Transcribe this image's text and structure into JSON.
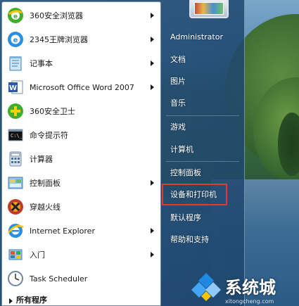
{
  "left_programs": [
    {
      "label": "360安全浏览器",
      "icon": "360-browser-icon",
      "has_arrow": true
    },
    {
      "label": "2345王牌浏览器",
      "icon": "2345-browser-icon",
      "has_arrow": true
    },
    {
      "label": "记事本",
      "icon": "notepad-icon",
      "has_arrow": true
    },
    {
      "label": "Microsoft Office Word 2007",
      "icon": "word-icon",
      "has_arrow": true
    },
    {
      "label": "360安全卫士",
      "icon": "360-safe-icon",
      "has_arrow": false
    },
    {
      "label": "命令提示符",
      "icon": "cmd-icon",
      "has_arrow": false
    },
    {
      "label": "计算器",
      "icon": "calculator-icon",
      "has_arrow": false
    },
    {
      "label": "控制面板",
      "icon": "control-panel-icon",
      "has_arrow": true
    },
    {
      "label": "穿越火线",
      "icon": "crossfire-icon",
      "has_arrow": false
    },
    {
      "label": "Internet Explorer",
      "icon": "ie-icon",
      "has_arrow": true
    },
    {
      "label": "入门",
      "icon": "getting-started-icon",
      "has_arrow": true
    },
    {
      "label": "Task Scheduler",
      "icon": "task-scheduler-icon",
      "has_arrow": false
    }
  ],
  "all_programs_label": "所有程序",
  "right_items": [
    {
      "label": "Administrator"
    },
    {
      "label": "文档"
    },
    {
      "label": "图片"
    },
    {
      "label": "音乐"
    },
    {
      "label": "游戏"
    },
    {
      "label": "计算机"
    },
    {
      "label": "控制面板"
    },
    {
      "label": "设备和打印机"
    },
    {
      "label": "默认程序"
    },
    {
      "label": "帮助和支持"
    }
  ],
  "highlighted_item": "设备和打印机",
  "highlight_color": "#e23a2c",
  "watermark": {
    "text": "系统城",
    "url": "xitongcheng.com"
  }
}
